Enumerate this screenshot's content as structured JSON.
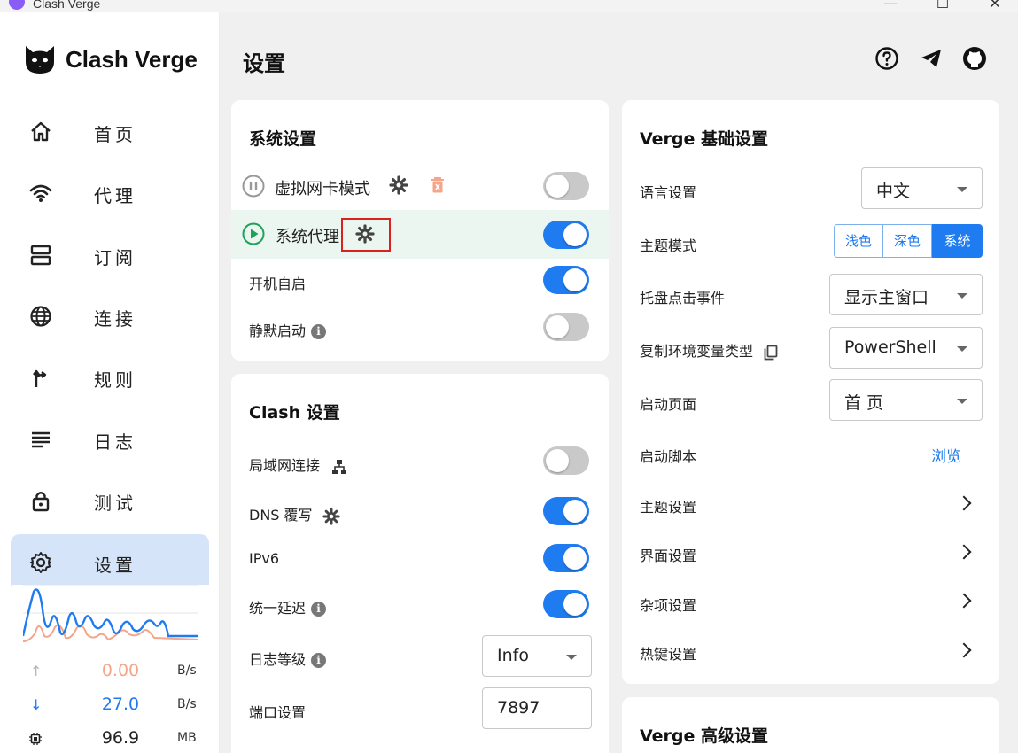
{
  "window": {
    "title": "Clash Verge",
    "min": "—",
    "max": "☐",
    "close": "✕"
  },
  "sidebar": {
    "logo_text": "Clash Verge",
    "items": [
      {
        "label": "首页",
        "icon": "home-icon"
      },
      {
        "label": "代理",
        "icon": "wifi-icon"
      },
      {
        "label": "订阅",
        "icon": "subscription-icon"
      },
      {
        "label": "连接",
        "icon": "globe-icon"
      },
      {
        "label": "规则",
        "icon": "rules-icon"
      },
      {
        "label": "日志",
        "icon": "log-icon"
      },
      {
        "label": "测试",
        "icon": "lock-icon"
      },
      {
        "label": "设置",
        "icon": "gear-icon",
        "active": true
      }
    ],
    "traffic": {
      "up": {
        "arrow": "↑",
        "value": "0.00",
        "unit": "B/s",
        "color": "#f4a58a"
      },
      "down": {
        "arrow": "↓",
        "value": "27.0",
        "unit": "B/s",
        "color": "#1e7bf0"
      },
      "mem": {
        "value": "96.9",
        "unit": "MB"
      }
    }
  },
  "header": {
    "title": "设置"
  },
  "system_settings": {
    "title": "系统设置",
    "tun_mode": {
      "label": "虚拟网卡模式",
      "enabled": false
    },
    "system_proxy": {
      "label": "系统代理",
      "enabled": true
    },
    "auto_launch": {
      "label": "开机自启",
      "enabled": true
    },
    "silent_start": {
      "label": "静默启动",
      "enabled": false
    }
  },
  "clash_settings": {
    "title": "Clash 设置",
    "lan": {
      "label": "局域网连接",
      "enabled": false
    },
    "dns": {
      "label": "DNS 覆写",
      "enabled": true
    },
    "ipv6": {
      "label": "IPv6",
      "enabled": true
    },
    "unified_delay": {
      "label": "统一延迟",
      "enabled": true
    },
    "log_level": {
      "label": "日志等级",
      "value": "Info"
    },
    "port": {
      "label": "端口设置",
      "value": "7897"
    }
  },
  "verge_basic": {
    "title": "Verge 基础设置",
    "language": {
      "label": "语言设置",
      "value": "中文"
    },
    "theme_mode": {
      "label": "主题模式",
      "options": [
        "浅色",
        "深色",
        "系统"
      ],
      "selected": "系统"
    },
    "tray_click": {
      "label": "托盘点击事件",
      "value": "显示主窗口"
    },
    "copy_env": {
      "label": "复制环境变量类型",
      "value": "PowerShell"
    },
    "start_page": {
      "label": "启动页面",
      "value": "首 页"
    },
    "start_script": {
      "label": "启动脚本",
      "action": "浏览"
    },
    "theme_settings": {
      "label": "主题设置"
    },
    "ui_settings": {
      "label": "界面设置"
    },
    "misc_settings": {
      "label": "杂项设置"
    },
    "hotkey_settings": {
      "label": "热键设置"
    }
  },
  "verge_advanced": {
    "title": "Verge 高级设置"
  },
  "colors": {
    "accent": "#1e7bf0",
    "highlight_row": "#eaf6ef",
    "play_green": "#21a05a",
    "annotation_red": "#d9221d",
    "delete_red": "#f4a58a"
  }
}
